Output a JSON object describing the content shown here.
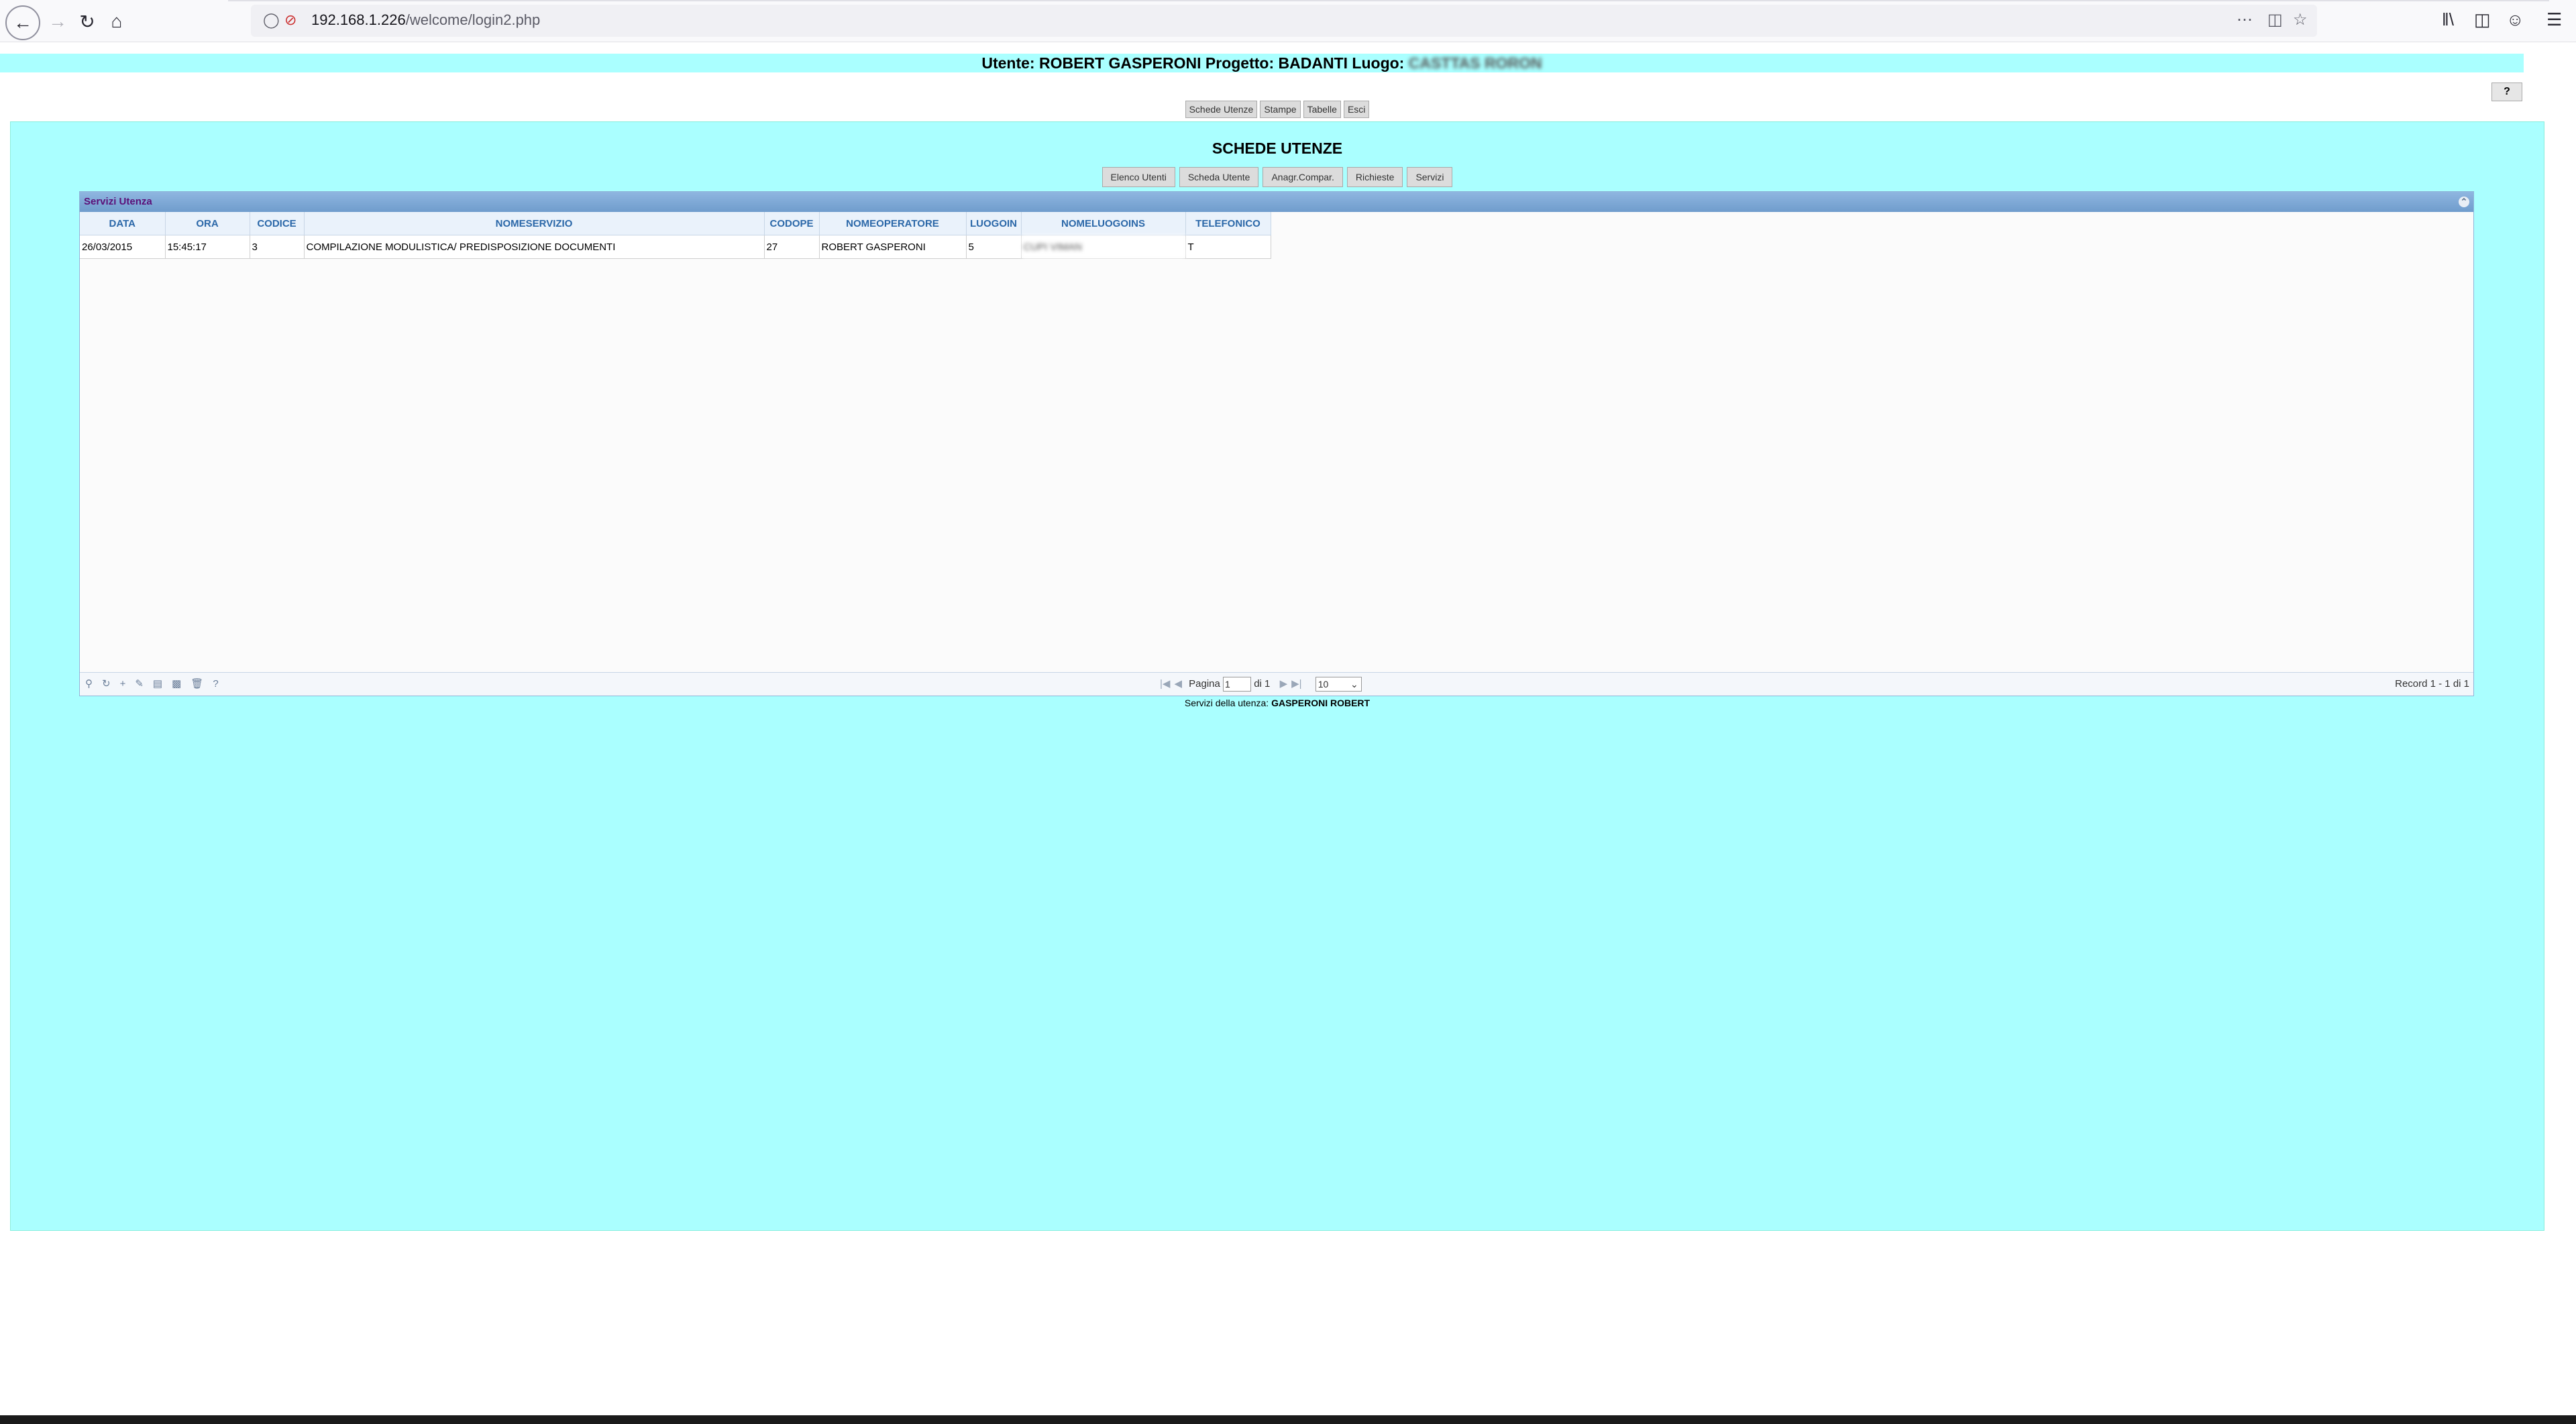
{
  "browser": {
    "url_host": "192.168.1.226",
    "url_path": "/welcome/login2.php"
  },
  "header": {
    "prefix": "Utente: ",
    "user": "ROBERT GASPERONI",
    "project_label": " Progetto: ",
    "project": "BADANTI",
    "place_label": " Luogo: ",
    "place_blurred": "CASTTAS RORON"
  },
  "top_menu": [
    "Schede Utenze",
    "Stampe",
    "Tabelle",
    "Esci"
  ],
  "help_label": "?",
  "page_title": "SCHEDE UTENZE",
  "sub_menu": [
    "Elenco Utenti",
    "Scheda Utente",
    "Anagr.Compar.",
    "Richieste",
    "Servizi"
  ],
  "grid": {
    "caption": "Servizi Utenza",
    "columns": [
      "DATA",
      "ORA",
      "CODICE",
      "NOMESERVIZIO",
      "CODOPE",
      "NOMEOPERATORE",
      "LUOGOIN",
      "NOMELUOGOINS",
      "TELEFONICO"
    ],
    "rows": [
      [
        "26/03/2015",
        "15:45:17",
        "3",
        "COMPILAZIONE MODULISTICA/ PREDISPOSIZIONE DOCUMENTI",
        "27",
        "ROBERT GASPERONI",
        "5",
        "CUPI VIMAN",
        "T"
      ]
    ],
    "pager": {
      "page_label": "Pagina",
      "page_value": "1",
      "of_label": "di 1",
      "rows_per_page": "10",
      "record_info": "Record 1 - 1 di 1"
    }
  },
  "footer_note": {
    "prefix": "Servizi della utenza: ",
    "name": "GASPERONI ROBERT"
  }
}
